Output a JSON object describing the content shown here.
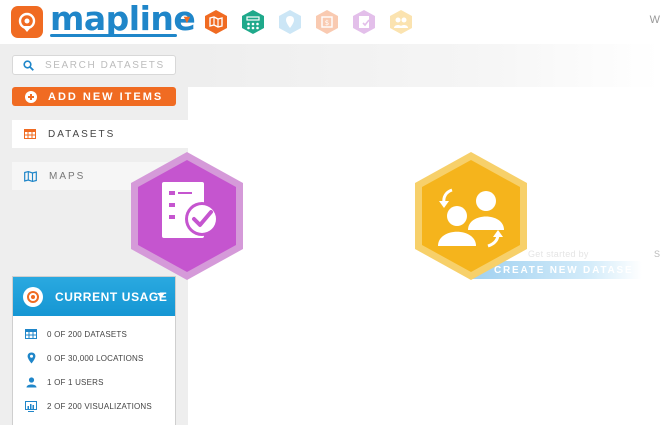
{
  "app": {
    "logo_text": "mapline",
    "corner_text": "W"
  },
  "nav_icons": [
    {
      "icon": "map-book-icon",
      "color": "#f06b22",
      "opacity": 1
    },
    {
      "icon": "territory-grid-icon",
      "color": "#1fa98b",
      "opacity": 1
    },
    {
      "icon": "location-pin-icon",
      "color": "#6fb9e6",
      "opacity": 0.35
    },
    {
      "icon": "dataset-icon",
      "color": "#f06b22",
      "opacity": 0.35
    },
    {
      "icon": "checklist-icon",
      "color": "#b04ac6",
      "opacity": 0.35
    },
    {
      "icon": "team-icon",
      "color": "#f5b21f",
      "opacity": 0.35
    }
  ],
  "sidebar": {
    "search_placeholder": "SEARCH DATASETS",
    "add_label": "ADD NEW ITEMS",
    "items": [
      {
        "label": "DATASETS",
        "icon": "table-icon",
        "active": true
      },
      {
        "label": "MAPS",
        "icon": "map-icon",
        "active": false
      }
    ]
  },
  "main": {
    "hint": "Get started by",
    "hint_edge": "S",
    "create_label": "CREATE NEW DATASE",
    "tiles": [
      {
        "icon": "checklist-icon",
        "color": "#c555cf"
      },
      {
        "icon": "team-exchange-icon",
        "color": "#f5b41c"
      }
    ]
  },
  "usage": {
    "title": "CURRENT USAGE",
    "rows": [
      {
        "icon": "table-icon",
        "text": "0 OF 200 DATASETS"
      },
      {
        "icon": "location-pin-icon",
        "text": "0 OF 30,000 LOCATIONS"
      },
      {
        "icon": "user-icon",
        "text": "1 OF 1 USERS"
      },
      {
        "icon": "chart-icon",
        "text": "2 OF 200 VISUALIZATIONS"
      }
    ]
  },
  "colors": {
    "brand_orange": "#f06b22",
    "brand_blue": "#1f86c9",
    "usage_blue": "#1596d3"
  }
}
